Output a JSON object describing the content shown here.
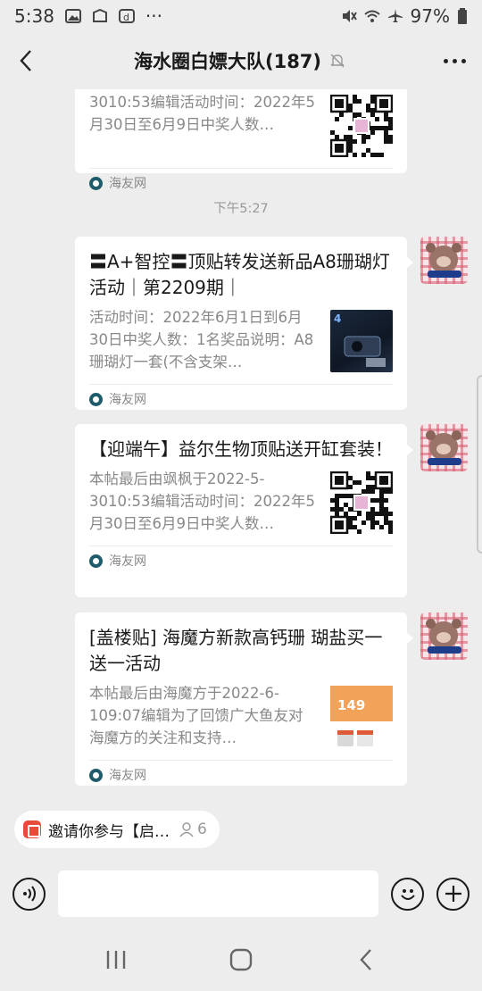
{
  "status_bar": {
    "time": "5:38",
    "battery": "97%"
  },
  "header": {
    "title": "海水圈白嫖大队(187)"
  },
  "messages": [
    {
      "title": "",
      "desc": "3010:53编辑活动时间：2022年5月30日至6月9日中奖人数…",
      "source": "海友网",
      "thumb": "qr-code"
    },
    {
      "title": "〓A+智控〓顶贴转发送新品A8珊瑚灯活动｜第2209期｜",
      "desc": "活动时间：2022年6月1日到6月30日中奖人数：1名奖品说明：A8珊瑚灯一套(不含支架…",
      "source": "海友网",
      "thumb": "product-photo"
    },
    {
      "title": "【迎端午】益尔生物顶贴送开缸套装！",
      "desc": "本帖最后由飒枫于2022-5-3010:53编辑活动时间：2022年5月30日至6月9日中奖人数…",
      "source": "海友网",
      "thumb": "qr-code"
    },
    {
      "title": "[盖楼贴] 海魔方新款高钙珊 瑚盐买一送一活动",
      "desc": "本帖最后由海魔方于2022-6-109:07编辑为了回馈广大鱼友对海魔方的关注和支持…",
      "source": "海友网",
      "thumb": "promo-banner",
      "thumb_text": "149"
    }
  ],
  "timestamp": "下午5:27",
  "invite": {
    "label": "邀请你参与【启…",
    "count": "6"
  },
  "input": {
    "placeholder": ""
  },
  "colors": {
    "background": "#ededed",
    "bubble": "#ffffff",
    "source_icon": "#1e5c6b",
    "invite_icon": "#e84b3c"
  }
}
